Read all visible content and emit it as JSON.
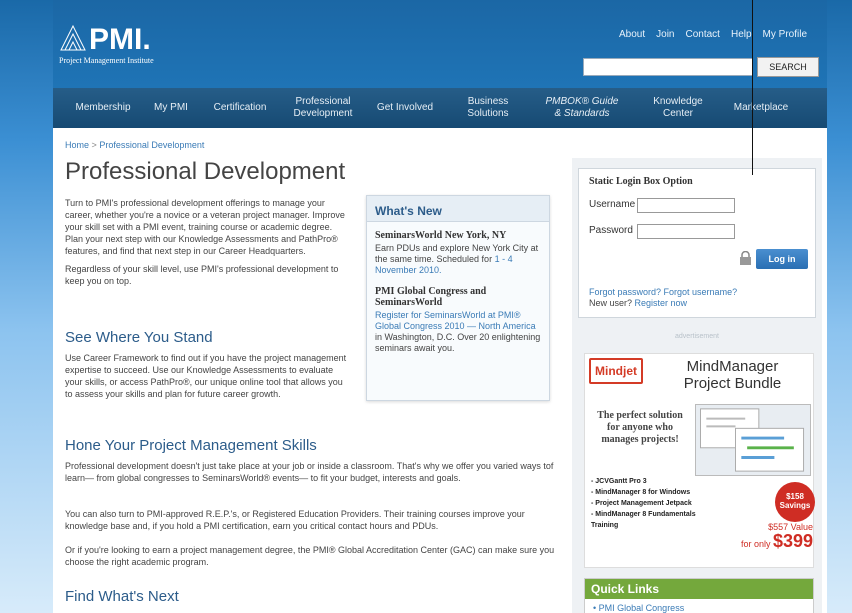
{
  "header": {
    "org_name": "Project Management Institute",
    "top_links": [
      "About",
      "Join",
      "Contact",
      "Help",
      "My Profile"
    ],
    "search_button": "SEARCH"
  },
  "nav": {
    "items": [
      {
        "label": "Membership"
      },
      {
        "label": "My PMI"
      },
      {
        "label": "Certification"
      },
      {
        "label": "Professional\nDevelopment"
      },
      {
        "label": "Get Involved"
      },
      {
        "label": "Business\nSolutions"
      },
      {
        "label": "PMBOK® Guide\n& Standards"
      },
      {
        "label": "Knowledge\nCenter"
      },
      {
        "label": "Marketplace"
      }
    ]
  },
  "breadcrumb": {
    "home": "Home",
    "sep": ">",
    "current": "Professional Development"
  },
  "main": {
    "title": "Professional Development",
    "intro_p1": "Turn to PMI's professional development offerings to manage your career, whether you're a novice or a veteran project manager. Improve your skill set with a PMI event, training course or academic degree. Plan your next step with our Knowledge Assessments and PathPro® features, and find that next step in our Career Headquarters.",
    "intro_p2": "Regardless of your skill level, use PMI's professional development to keep you on top.",
    "h2_stand": "See Where You Stand",
    "stand_p": "Use Career Framework to find out if you have the project management expertise to succeed. Use our Knowledge Assessments to evaluate your skills, or access PathPro®, our unique online tool that allows you to assess your skills and plan for future career growth.",
    "h2_hone": "Hone Your Project Management Skills",
    "hone_p1": "Professional development doesn't just take place at your job or inside a classroom. That's why we offer you varied ways tof learn— from global congresses to SeminarsWorld® events— to fit your budget, interests and goals.",
    "hone_p2": "You can also turn to PMI-approved R.E.P.'s, or Registered Education Providers. Their training courses improve your knowledge base and, if you hold a PMI certification, earn you critical contact hours and PDUs.",
    "hone_p3": "Or if you're looking to earn a project management degree, the PMI® Global Accreditation Center (GAC) can make sure you choose the right academic program.",
    "h2_next": "Find What's Next"
  },
  "whats_new": {
    "heading": "What's New",
    "item1_title": "SeminarsWorld New York, NY",
    "item1_text": "Earn PDUs and explore New York City at the same time. Scheduled for ",
    "item1_link": "1 - 4 November 2010.",
    "item2_title": "PMI Global Congress and SeminarsWorld",
    "item2_link": "Register for SeminarsWorld at PMI® Global Congress 2010 — North America",
    "item2_text": " in Washington, D.C. Over 20 enlightening seminars await you."
  },
  "login": {
    "title": "Static Login Box Option",
    "username_label": "Username",
    "password_label": "Password",
    "button": "Log in",
    "forgot": "Forgot password? Forgot username?",
    "new_user": "New user? ",
    "register": "Register now"
  },
  "ad": {
    "label": "advertisement",
    "brand": "Mindjet",
    "title": "MindManager\nProject Bundle",
    "tagline": "The perfect solution for anyone who manages projects!",
    "list": [
      "- JCVGantt Pro 3",
      "- MindManager 8 for Windows",
      "- Project Management Jetpack",
      "- MindManager 8 Fundamentals Training"
    ],
    "burst": "$158 Savings",
    "value": "$557 Value",
    "offer": "for only ",
    "price": "$399"
  },
  "quick_links": {
    "heading": "Quick Links",
    "items": [
      "PMI Global Congress"
    ]
  },
  "colors": {
    "brand_blue": "#1f74b6",
    "nav_dark": "#1a4f79",
    "link": "#3a7bb6",
    "quick_links_green": "#74a83c",
    "ad_red": "#cf2d24"
  }
}
